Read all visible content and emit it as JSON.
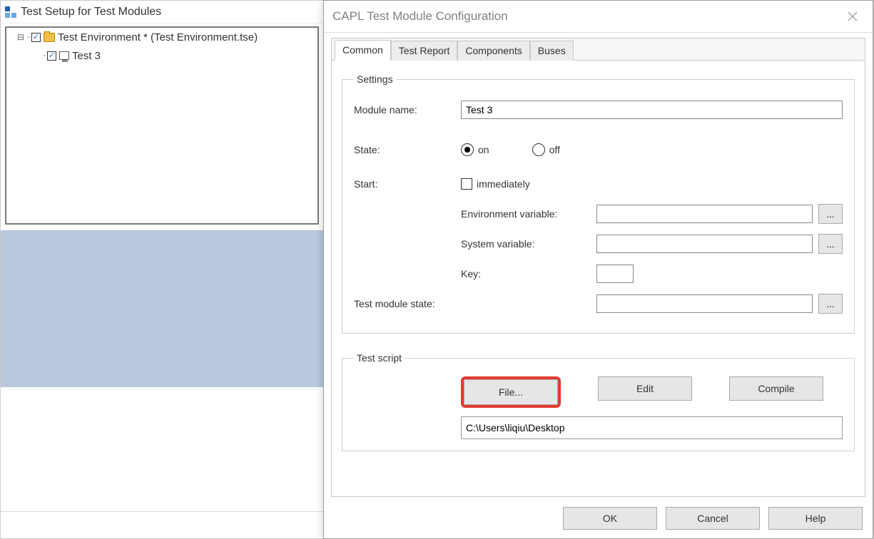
{
  "bgWindow": {
    "title": "Test Setup for Test Modules",
    "tree": {
      "root_label": "Test Environment *  (Test Environment.tse)",
      "child_label": "Test 3"
    }
  },
  "dialog": {
    "title": "CAPL Test Module Configuration",
    "tabs": [
      "Common",
      "Test Report",
      "Components",
      "Buses"
    ],
    "settings": {
      "legend": "Settings",
      "module_name_label": "Module name:",
      "module_name_value": "Test 3",
      "state_label": "State:",
      "state_on": "on",
      "state_off": "off",
      "start_label": "Start:",
      "immediately_label": "immediately",
      "env_var_label": "Environment variable:",
      "env_var_value": "",
      "sys_var_label": "System variable:",
      "sys_var_value": "",
      "key_label": "Key:",
      "key_value": "",
      "tms_label": "Test module state:",
      "tms_value": "",
      "dots": "..."
    },
    "script": {
      "legend": "Test script",
      "file_btn": "File...",
      "edit_btn": "Edit",
      "compile_btn": "Compile",
      "path": "C:\\Users\\liqiu\\Desktop"
    },
    "footer": {
      "ok": "OK",
      "cancel": "Cancel",
      "help": "Help"
    }
  }
}
